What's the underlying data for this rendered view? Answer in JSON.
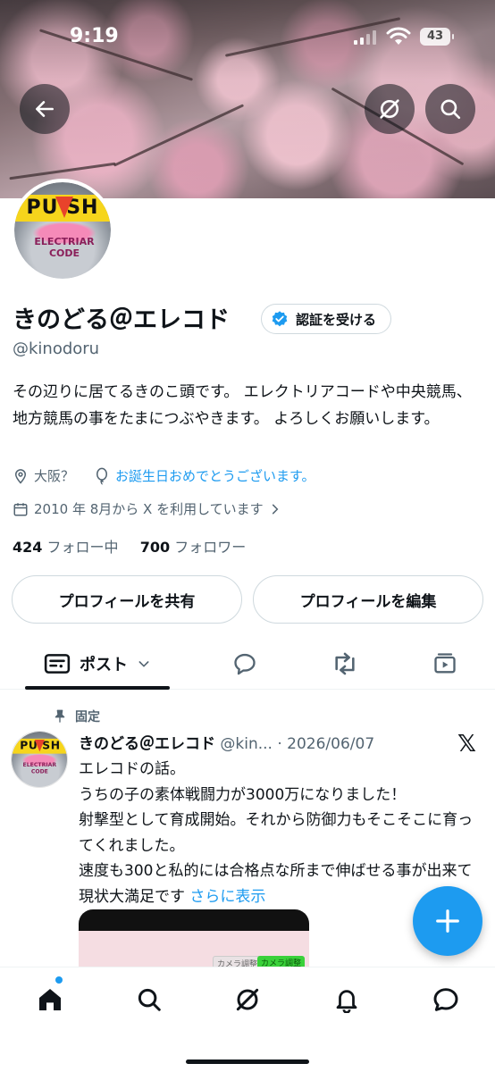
{
  "status_bar": {
    "time": "9:19",
    "battery": "43"
  },
  "header": {
    "back_icon": "arrow-left-icon",
    "grok_icon": "grok-icon",
    "search_icon": "search-icon"
  },
  "avatar": {
    "logo_top": "PU  SH",
    "logo_bottom": "ELECTRIAR CODE"
  },
  "profile": {
    "display_name": "きのどる＠エレコド",
    "verify_label": "認証を受ける",
    "handle": "@kinodoru",
    "bio": "その辺りに居てるきのこ頭です。 エレクトリアコードや中央競馬、地方競馬の事をたまにつぶやきます。 よろしくお願いします。",
    "location": "大阪？",
    "birthday": "お誕生日おめでとうございます。",
    "joined": "2010 年 8月から X を利用しています",
    "following_count": "424",
    "following_label": "フォロー中",
    "followers_count": "700",
    "followers_label": "フォロワー"
  },
  "actions": {
    "share_label": "プロフィールを共有",
    "edit_label": "プロフィールを編集"
  },
  "tabs": {
    "posts_label": "ポスト",
    "active": "posts"
  },
  "post": {
    "pinned_label": "固定",
    "author_name": "きのどる＠エレコド",
    "author_meta": "@kin... · 2026/06/07",
    "lines": [
      "エレコドの話。",
      "うちの子の素体戦闘力が3000万になりました！",
      "射撃型として育成開始。それから防御力もそこそこに育ってくれました。",
      "速度も300と私的には合格点な所まで伸ばせる事が出来て現状大満足です"
    ],
    "show_more": "さらに表示",
    "media_chip_1": "カメラ調整",
    "media_chip_2": "カメラ調整"
  },
  "bottom_nav": [
    "home-icon",
    "search-icon",
    "grok-icon",
    "bell-icon",
    "messages-icon"
  ],
  "colors": {
    "accent": "#1d9bf0",
    "text": "#0f1419",
    "secondary": "#536471",
    "border": "#cfd9de"
  }
}
